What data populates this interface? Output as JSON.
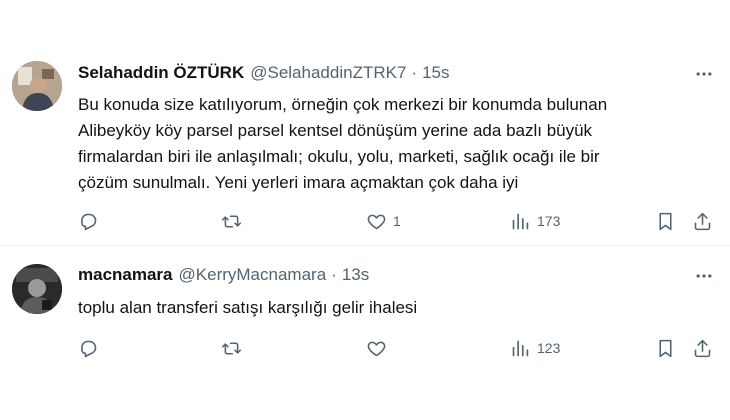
{
  "tweets": [
    {
      "display_name": "Selahaddin ÖZTÜRK",
      "handle": "@SelahaddinZTRK7",
      "separator": "·",
      "time": "15s",
      "text": "Bu konuda size katılıyorum, örneğin çok merkezi bir konumda bulunan\nAlibeyköy köy parsel parsel kentsel dönüşüm yerine ada bazlı büyük\nfirmalardan biri ile anlaşılmalı; okulu, yolu, marketi, sağlık ocağı ile bir\nçözüm sunulmalı. Yeni yerleri imara açmaktan çok daha iyi",
      "reply_count": "",
      "retweet_count": "",
      "like_count": "1",
      "view_count": "173"
    },
    {
      "display_name": "macnamara",
      "handle": "@KerryMacnamara",
      "separator": "·",
      "time": "13s",
      "text": "toplu alan transferi satışı karşılığı gelir ihalesi",
      "reply_count": "",
      "retweet_count": "",
      "like_count": "",
      "view_count": "123"
    }
  ],
  "icons": {
    "reply": "reply-icon",
    "retweet": "retweet-icon",
    "like": "heart-icon",
    "views": "views-icon",
    "bookmark": "bookmark-icon",
    "share": "share-icon",
    "more": "more-icon"
  },
  "colors": {
    "text_primary": "#0f1419",
    "text_secondary": "#536471",
    "divider": "#eff3f4"
  }
}
